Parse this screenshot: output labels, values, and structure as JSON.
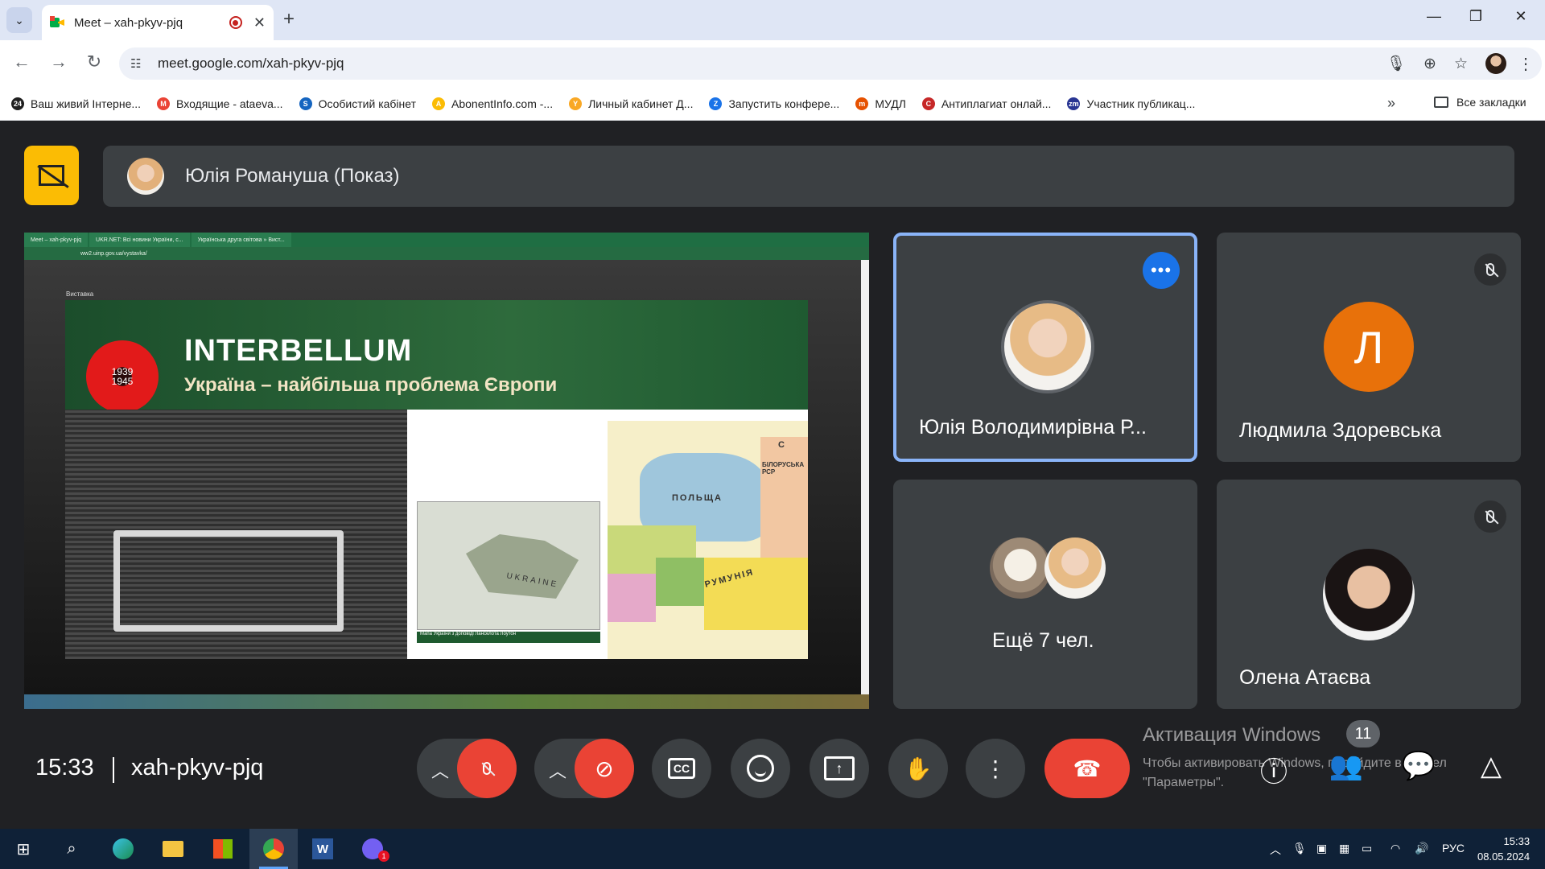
{
  "browser": {
    "tab_title": "Meet – xah-pkyv-pjq",
    "tab_close": "✕",
    "new_tab": "+",
    "url": "meet.google.com/xah-pkyv-pjq",
    "icons": [
      "tab-search-icon",
      "record-icon",
      "back-icon",
      "forward-icon",
      "reload-icon",
      "site-settings-icon",
      "mic-icon",
      "zoom-icon",
      "star-icon",
      "profile-icon",
      "menu-icon"
    ],
    "bookmarks": [
      {
        "label": "Ваш живий Інтерне...",
        "color": "#1f1f1f",
        "glyph": "24"
      },
      {
        "label": "Входящие - ataeva...",
        "color": "#ea4335",
        "glyph": "M"
      },
      {
        "label": "Особистий кабінет",
        "color": "#1565c0",
        "glyph": "S"
      },
      {
        "label": "AbonentInfo.com -...",
        "color": "#fbbc04",
        "glyph": "A"
      },
      {
        "label": "Личный кабинет Д...",
        "color": "#f9a825",
        "glyph": "Y"
      },
      {
        "label": "Запустить конфере...",
        "color": "#1a73e8",
        "glyph": "Z"
      },
      {
        "label": "МУДЛ",
        "color": "#e65100",
        "glyph": "m"
      },
      {
        "label": "Антиплагиат онлай...",
        "color": "#c62828",
        "glyph": "C"
      },
      {
        "label": "Участник публикац...",
        "color": "#283593",
        "glyph": "zm"
      }
    ],
    "more_bookmarks": "»",
    "all_bookmarks": "Все закладки"
  },
  "meet": {
    "presenter": "Юлія Романуша (Показ)",
    "shared_screen": {
      "tabs": [
        "Meet – xah-pkyv-pjq",
        "UKR.NET: Всі новини України, с...",
        "Українська друга світова » Вист..."
      ],
      "url": "ww2.uinp.gov.ua/vystavka/",
      "page_label": "Виставка",
      "slide_title": "INTERBELLUM",
      "slide_subtitle": "Україна – найбільша проблема Європи",
      "poppy_years": [
        "1939",
        "1945"
      ],
      "map_label": "UKRAINE",
      "map_caption": "Мапа України з доповіді Ланселота Лоутон",
      "map2_labels": [
        "ПОЛЬЩА",
        "РУМУНІЯ",
        "С",
        "БІЛОРУСЬКА РСР"
      ]
    },
    "participants": [
      {
        "name": "Юлія Володимирівна Р...",
        "active": true
      },
      {
        "name": "Людмила Здоревська",
        "initial": "Л"
      },
      {
        "name": "Ещё 7 чел."
      },
      {
        "name": "Олена Атаєва"
      }
    ],
    "time": "15:33",
    "meeting_code": "xah-pkyv-pjq",
    "participant_count": "11",
    "activation_title": "Активация Windows",
    "activation_text": "Чтобы активировать Windows, перейдите в раздел \"Параметры\"."
  },
  "taskbar": {
    "lang": "РУС",
    "time": "15:33",
    "date": "08.05.2024",
    "word_label": "W",
    "viber_badge": "1"
  }
}
